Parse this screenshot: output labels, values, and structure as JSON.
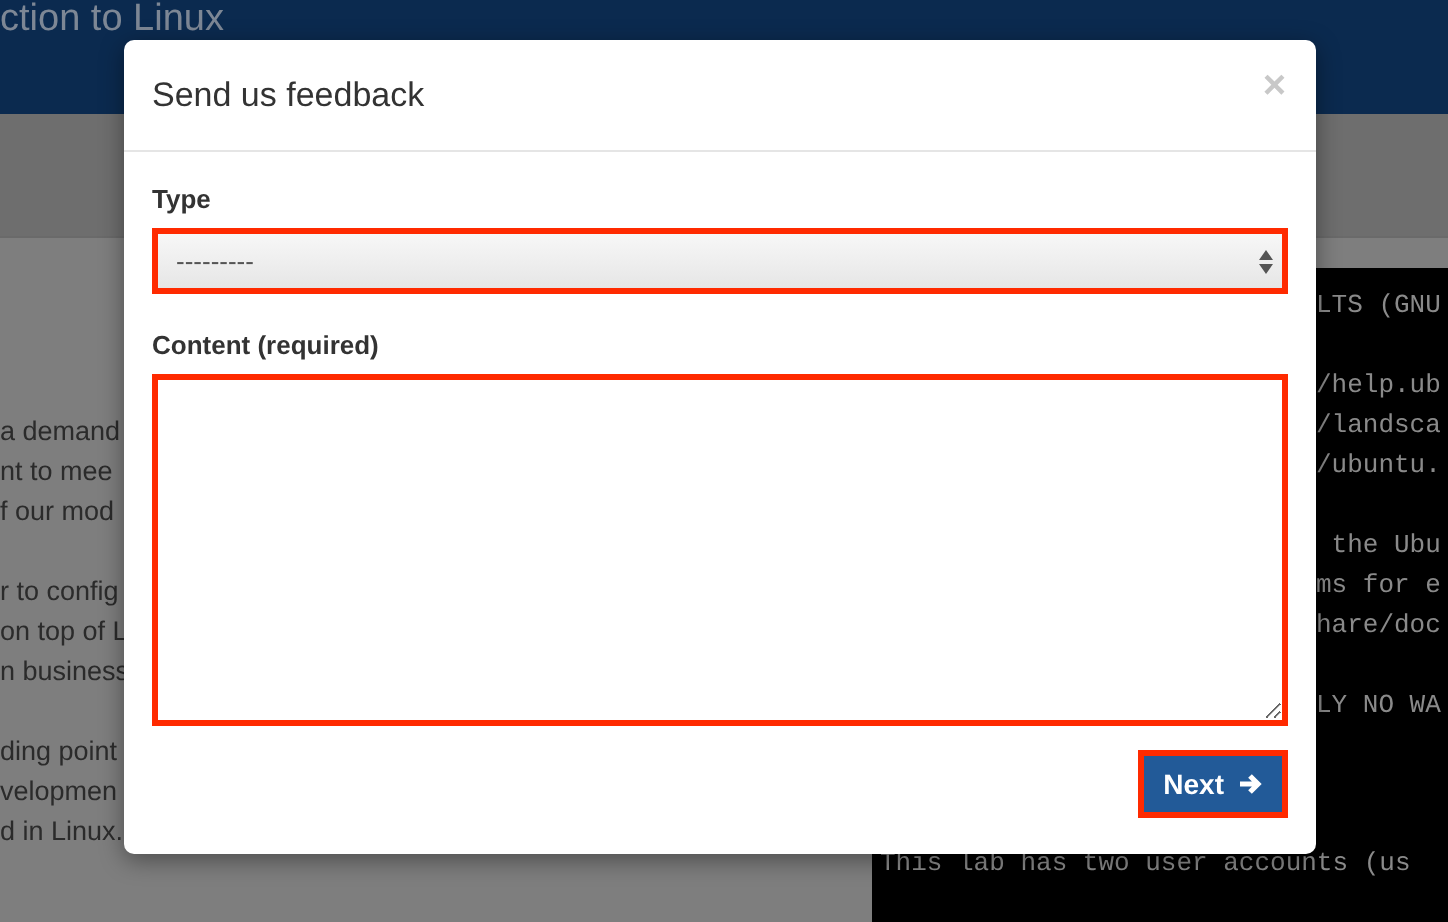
{
  "page": {
    "header_title": "ction to Linux",
    "paragraph_lines": [
      [
        "a demand",
        "nt to mee",
        "f our mod"
      ],
      [
        "r to config",
        "on top of L",
        "n business"
      ],
      [
        "ding point",
        "velopmen",
        "d in Linux."
      ]
    ],
    "terminal_blocks": [
      [
        "LTS (GNU"
      ],
      [
        "/help.ub",
        "/landsca",
        "/ubuntu."
      ],
      [
        " the Ubu",
        "ms for e",
        "hare/doc"
      ],
      [
        "LY NO WA"
      ]
    ],
    "terminal_footer": "This lab has two user accounts (us"
  },
  "dialog": {
    "title": "Send us feedback",
    "close": "×",
    "type_label": "Type",
    "type_value": "---------",
    "content_label": "Content (required)",
    "next_button": "Next"
  }
}
